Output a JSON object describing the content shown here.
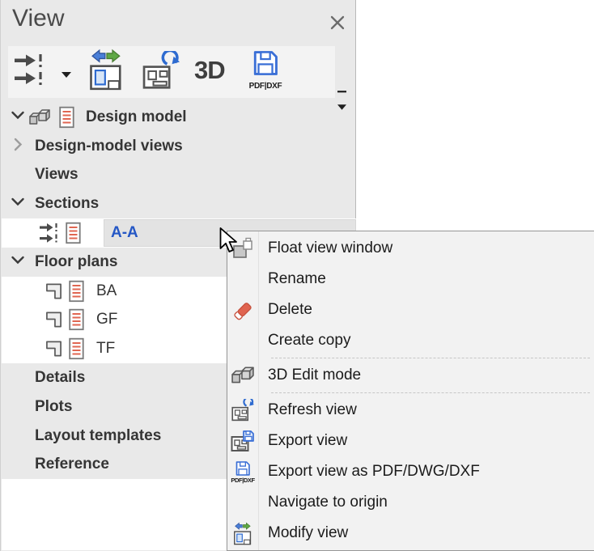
{
  "colors": {
    "accent_blue": "#2457c5",
    "icon_blue": "#2e6bd0",
    "icon_green": "#5fa845",
    "icon_red": "#e06450",
    "doc_line_red": "#e06651",
    "panel_bg": "#e9e9e9",
    "toolbar_bg": "#f3f3f3",
    "menu_bg": "#f2f2f2",
    "selected_item_bg": "#e3e3e3"
  },
  "panel": {
    "title": "View",
    "toolbar": {
      "buttons": [
        {
          "name": "create-section-view-button",
          "icon": "section-marker-icon",
          "dropdown": true
        },
        {
          "name": "modify-view-button",
          "icon": "modify-view-icon"
        },
        {
          "name": "refresh-view-button",
          "icon": "refresh-view-icon"
        },
        {
          "name": "3d-view-button",
          "icon": "3d-text-icon",
          "label": "3D"
        },
        {
          "name": "export-pdf-dxf-button",
          "icon": "export-pdf-dxf-icon",
          "label": "PDF|DXF"
        }
      ],
      "overflow_buttons": [
        {
          "name": "toolbar-collapse-button",
          "icon": "minus-icon"
        },
        {
          "name": "toolbar-more-button",
          "icon": "triangle-down-icon"
        }
      ]
    },
    "tree": [
      {
        "label": "Design model",
        "kind": "root",
        "chevron": "down",
        "bold": true,
        "icons": [
          "model-3d-icon",
          "view-list-icon"
        ]
      },
      {
        "label": "Design-model views",
        "kind": "group",
        "chevron": "right",
        "bold": true
      },
      {
        "label": "Views",
        "kind": "group",
        "bold": true
      },
      {
        "label": "Sections",
        "kind": "group",
        "chevron": "down",
        "bold": true
      },
      {
        "label": "A-A",
        "kind": "section-item",
        "white": true,
        "selected": true,
        "bold": true,
        "icons": [
          "section-view-icon",
          "view-list-icon"
        ]
      },
      {
        "label": "Floor plans",
        "kind": "group",
        "chevron": "down",
        "bold": true
      },
      {
        "label": "BA",
        "kind": "plan-item",
        "white": true,
        "icons": [
          "plan-view-icon",
          "view-list-icon"
        ]
      },
      {
        "label": "GF",
        "kind": "plan-item",
        "white": true,
        "icons": [
          "plan-view-icon",
          "view-list-icon"
        ]
      },
      {
        "label": "TF",
        "kind": "plan-item",
        "white": true,
        "icons": [
          "plan-view-icon",
          "view-list-icon"
        ]
      },
      {
        "label": "Details",
        "kind": "group",
        "bold": true
      },
      {
        "label": "Plots",
        "kind": "group",
        "bold": true
      },
      {
        "label": "Layout templates",
        "kind": "group",
        "bold": true
      },
      {
        "label": "Reference",
        "kind": "group",
        "bold": true
      }
    ]
  },
  "context_menu": {
    "items": [
      {
        "label": "Float view window",
        "icon": "float-window-icon"
      },
      {
        "label": "Rename"
      },
      {
        "label": "Delete",
        "icon": "eraser-icon"
      },
      {
        "label": "Create copy"
      },
      {
        "separator": true
      },
      {
        "label": "3D Edit mode",
        "icon": "model-3d-icon"
      },
      {
        "separator": true
      },
      {
        "label": "Refresh view",
        "icon": "refresh-view-icon"
      },
      {
        "label": "Export view",
        "icon": "export-view-icon"
      },
      {
        "label": "Export view as PDF/DWG/DXF",
        "icon": "export-pdf-dxf-icon",
        "icon_label": "PDF|DXF"
      },
      {
        "label": "Navigate to origin"
      },
      {
        "label": "Modify view",
        "icon": "modify-view-icon"
      }
    ]
  },
  "cursor": {
    "icon": "mouse-pointer-icon"
  }
}
